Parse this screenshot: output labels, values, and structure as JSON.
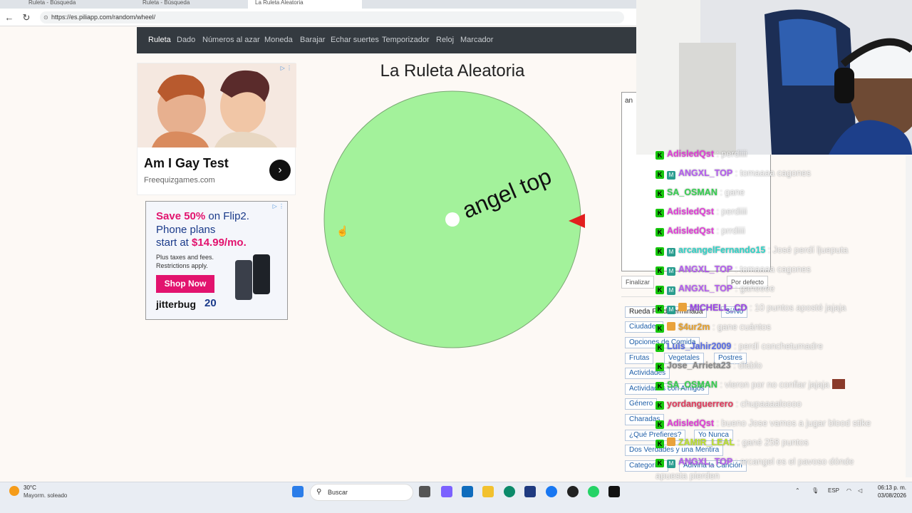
{
  "browser": {
    "tabs": [
      {
        "label": "Ruleta - Búsqueda",
        "active": false
      },
      {
        "label": "Ruleta - Búsqueda",
        "active": false
      },
      {
        "label": "La Ruleta Aleatoria",
        "active": true
      }
    ],
    "url": "https://es.piliapp.com/random/wheel/"
  },
  "navbar": {
    "items": [
      "Ruleta",
      "Dado",
      "Números al azar",
      "Moneda",
      "Barajar",
      "Echar suertes",
      "Temporizador",
      "Reloj",
      "Marcador"
    ],
    "active": "Ruleta"
  },
  "ad1": {
    "title": "Am I Gay Test",
    "source": "Freequizgames.com",
    "adchoice": "▷ ⋮"
  },
  "ad2": {
    "save": "Save 50%",
    "save_rest": " on Flip2.",
    "line2": "Phone plans",
    "line3_pre": "start at ",
    "line3_price": "$14.99/mo.",
    "fine": "Plus taxes and fees. Restrictions apply.",
    "button": "Shop Now",
    "brand": "jitterbug",
    "years": "20",
    "adchoice": "▷ ⋮"
  },
  "wheel": {
    "title": "La Ruleta Aleatoria",
    "segment_label": "angel top",
    "segment_color": "#a3f29b",
    "pointer_color": "#e21f1f"
  },
  "panel": {
    "entries_text": "an",
    "finish_button": "Finalizar",
    "default_button": "Por defecto",
    "presets": [
      "Rueda Predeterminada",
      "Sí/No",
      "Ciudades",
      "Opciones de Comida",
      "Frutas",
      "Vegetales",
      "Postres",
      "Actividades",
      "Actividades con Amigos",
      "Género",
      "Charadas",
      "¿Qué Prefieres?",
      "Yo Nunca",
      "Dos Verdades y una Mentira",
      "Categorías",
      "Adivina la Canción"
    ]
  },
  "chat": [
    {
      "user": "AdisledQst",
      "text": " : perdiiii",
      "color": "#e23bd8",
      "badges": [
        "k"
      ]
    },
    {
      "user": "ANGXL_TOP",
      "text": " : tomaaaa cagones",
      "color": "#b45cf0",
      "badges": [
        "k",
        "m"
      ]
    },
    {
      "user": "SA_OSMAN",
      "text": " : gane",
      "color": "#34d04f",
      "badges": [
        "k"
      ]
    },
    {
      "user": "AdisledQst",
      "text": " : perdiiii",
      "color": "#e23bd8",
      "badges": [
        "k"
      ]
    },
    {
      "user": "AdisledQst",
      "text": " : prrdiiii",
      "color": "#e23bd8",
      "badges": [
        "k"
      ]
    },
    {
      "user": "arcangelFernando15",
      "text": " : José perdí ljueputa",
      "color": "#2fd4c8",
      "badges": [
        "k",
        "m"
      ]
    },
    {
      "user": "ANGXL_TOP",
      "text": " : tomaaaa cagones",
      "color": "#b45cf0",
      "badges": [
        "k",
        "m"
      ]
    },
    {
      "user": "ANGXL_TOP",
      "text": " : ganeeee",
      "color": "#b45cf0",
      "badges": [
        "k",
        "m"
      ]
    },
    {
      "user": "MICHELL_CD",
      "text": " : 10 puntos aposté jajaja",
      "color": "#9a43e8",
      "badges": [
        "k",
        "m",
        "g"
      ]
    },
    {
      "user": "$4ur2m",
      "text": " : gane cuántos",
      "color": "#e6a02c",
      "badges": [
        "k",
        "g"
      ]
    },
    {
      "user": "Luis_Jahir2009",
      "text": " : perdí conchetumadre",
      "color": "#5a6ee8",
      "badges": [
        "k"
      ]
    },
    {
      "user": "Jose_Arrieta23",
      "text": " : diablo",
      "color": "#6d6d6d",
      "badges": [
        "k"
      ]
    },
    {
      "user": "SA_OSMAN",
      "text": " : vieron por no confiar jajaja",
      "color": "#34d04f",
      "badges": [
        "k"
      ]
    },
    {
      "user": "yordanguerrero",
      "text": " : chupaaaaloooo",
      "color": "#e23b5d",
      "badges": [
        "k"
      ]
    },
    {
      "user": "AdisledQst",
      "text": " : bueno Jose vamos a jugar blood stike",
      "color": "#e23bd8",
      "badges": [
        "k"
      ]
    },
    {
      "user": "ZAMIR_LEAL",
      "text": " : gané 258 puntos",
      "color": "#b9e02c",
      "badges": [
        "k",
        "g"
      ]
    },
    {
      "user": "ANGXL_TOP",
      "text": " : arcangel es el pavoso dónde",
      "color": "#b45cf0",
      "badges": [
        "k",
        "m"
      ]
    }
  ],
  "chat_tail": "apuesta pierden",
  "taskbar": {
    "weather_temp": "30°C",
    "weather_desc": "Mayorm. soleado",
    "search": "Buscar",
    "lang": "ESP",
    "time": "06:13 p. m.",
    "date": "03/08/2026"
  }
}
